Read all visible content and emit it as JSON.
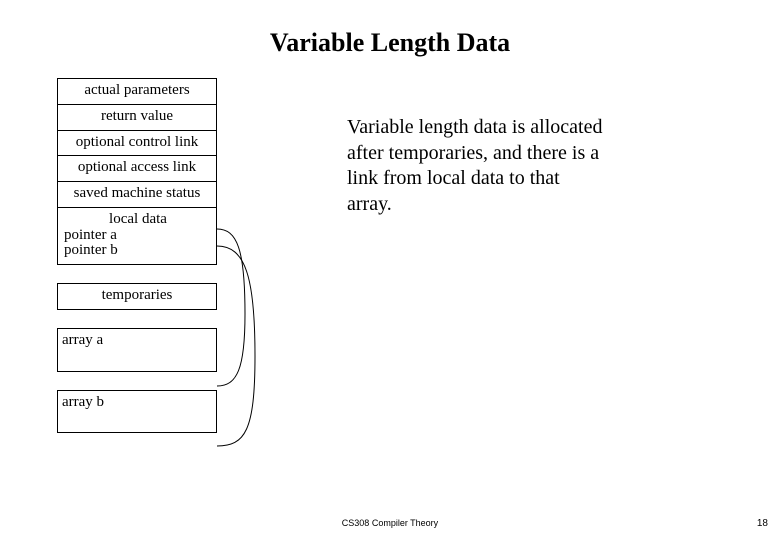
{
  "title": "Variable Length Data",
  "stack": {
    "actual_params": "actual parameters",
    "return_value": "return value",
    "control_link": "optional control link",
    "access_link": "optional access link",
    "machine_status": "saved machine status",
    "local_data_hdr": "local data",
    "pointer_a": "pointer a",
    "pointer_b": "pointer b",
    "temporaries": "temporaries",
    "array_a": "array a",
    "array_b": "array b"
  },
  "description": "Variable length data is allocated after temporaries, and there is a link from local data to that array.",
  "footer": {
    "course": "CS308 Compiler Theory",
    "page": "18"
  }
}
